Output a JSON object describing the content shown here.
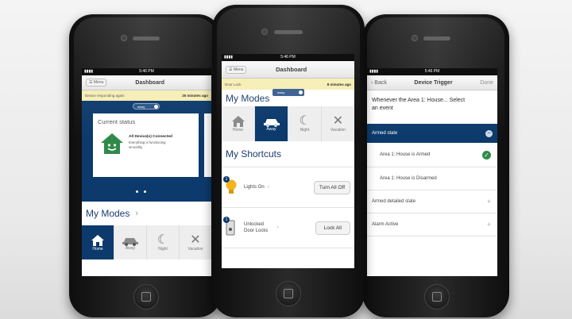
{
  "status_time": "5:46 PM",
  "signal": "▮▮▮▮",
  "phone_left": {
    "menu_label": "☰ Menu",
    "title": "Dashboard",
    "alert_text": "Device responding again",
    "alert_time": "20 minutes ago",
    "toggle_label": "away",
    "status_heading": "Current status",
    "status_main": "All Device(s) Connected",
    "status_sub": "Everything is functioning smoothly",
    "modes_title": "My Modes",
    "modes_chevron": "›",
    "modes": [
      {
        "label": "Home",
        "icon": "house-icon"
      },
      {
        "label": "Away",
        "icon": "car-icon"
      },
      {
        "label": "Night",
        "icon": "moon-icon"
      },
      {
        "label": "Vacation",
        "icon": "plane-icon"
      }
    ]
  },
  "phone_center": {
    "menu_label": "☰ Menu",
    "title": "Dashboard",
    "alert_text": "Door Lock",
    "alert_time": "8 minutes ago",
    "modes_title": "My Modes",
    "toggle_label": "away",
    "modes": [
      {
        "label": "Home",
        "icon": "house-icon"
      },
      {
        "label": "Away",
        "icon": "car-icon"
      },
      {
        "label": "Night",
        "icon": "moon-icon"
      },
      {
        "label": "Vacation",
        "icon": "plane-icon"
      }
    ],
    "shortcuts_title": "My Shortcuts",
    "shortcuts": [
      {
        "label": "Lights On",
        "chevron": "›",
        "button": "Turn All Off",
        "badge": "1"
      },
      {
        "label": "Unlocked Door Locks",
        "chevron": "›",
        "button": "Lock All",
        "badge": "1"
      }
    ]
  },
  "phone_right": {
    "back_label": "‹ Back",
    "title": "Device Trigger",
    "done_label": "Done",
    "prompt": "Whenever the Area 1: House... Select an event",
    "header_option": "Armed state",
    "options": [
      {
        "label": "Area 1: House is Armed",
        "selected": true
      },
      {
        "label": "Area 1: House is Disarmed",
        "selected": false
      }
    ],
    "more_options": [
      "Armed detailed state",
      "Alarm Active"
    ]
  }
}
